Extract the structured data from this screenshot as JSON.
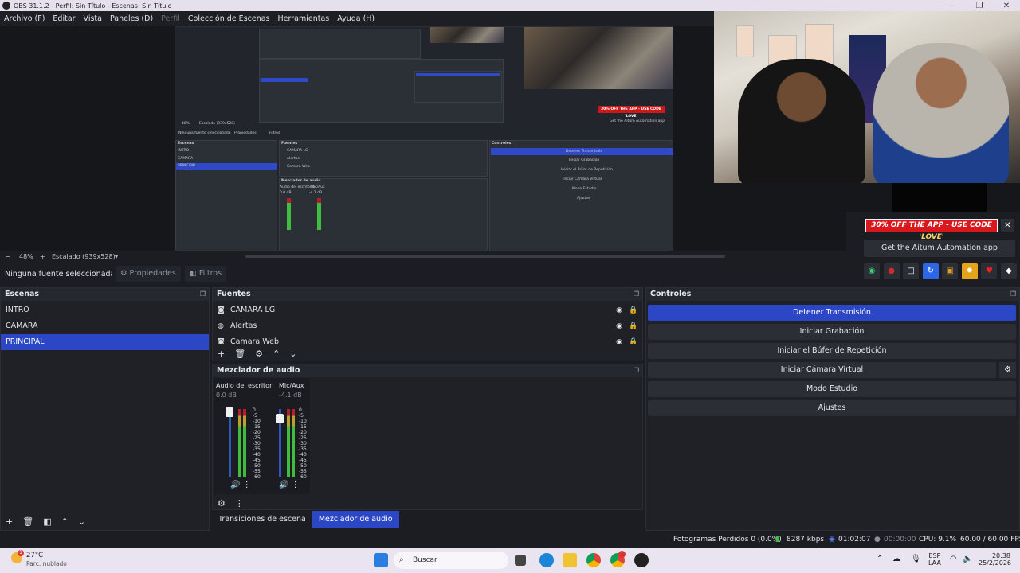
{
  "window": {
    "title": "OBS 31.1.2 - Perfil: Sin Título - Escenas: Sin Título",
    "minimize": "—",
    "maximize": "❐",
    "close": "✕"
  },
  "menu": [
    {
      "label": "Archivo (F)",
      "disabled": false
    },
    {
      "label": "Editar",
      "disabled": false
    },
    {
      "label": "Vista",
      "disabled": false
    },
    {
      "label": "Paneles (D)",
      "disabled": false
    },
    {
      "label": "Perfil",
      "disabled": true
    },
    {
      "label": "Colección de Escenas",
      "disabled": false
    },
    {
      "label": "Herramientas",
      "disabled": false
    },
    {
      "label": "Ayuda (H)",
      "disabled": false
    }
  ],
  "zoom": {
    "minus": "−",
    "level": "48%",
    "plus": "+",
    "scaled": "Escalado (939x528)",
    "dropdown": "▾"
  },
  "source_toolbar": {
    "no_source": "Ninguna fuente seleccionada",
    "properties": "Propiedades",
    "filters": "Filtros"
  },
  "promo": {
    "text": "30% OFF THE APP - USE CODE ",
    "code": "'LOVE'",
    "close": "✕",
    "aitum_button": "Get the Aitum Automation app"
  },
  "scenes": {
    "title": "Escenas",
    "items": [
      "INTRO",
      "CAMARA",
      "PRINCIPAL"
    ],
    "active_index": 2
  },
  "sources": {
    "title": "Fuentes",
    "items": [
      "CAMARA LG",
      "Alertas",
      "Camara Web"
    ]
  },
  "mixer": {
    "title": "Mezclador de audio",
    "channels": [
      {
        "name": "Audio del escritorio",
        "db": "0.0 dB"
      },
      {
        "name": "Mic/Aux",
        "db": "-4.1 dB"
      }
    ],
    "scale": [
      "0",
      "-5",
      "-10",
      "-15",
      "-20",
      "-25",
      "-30",
      "-35",
      "-40",
      "-45",
      "-50",
      "-55",
      "-60"
    ]
  },
  "tabs": [
    "Transiciones de escena",
    "Mezclador de audio"
  ],
  "active_tab": 1,
  "controls": {
    "title": "Controles",
    "buttons": [
      "Detener Transmisión",
      "Iniciar Grabación",
      "Iniciar el Búfer de Repetición",
      "Iniciar Cámara Virtual",
      "Modo Estudio",
      "Ajustes"
    ]
  },
  "status": {
    "dropped": "Fotogramas Perdidos 0 (0.0%)",
    "kbps": "8287 kbps",
    "stream_time": "01:02:07",
    "rec_time": "00:00:00",
    "cpu": "CPU: 9.1%",
    "fps": "60.00 / 60.00 FPS"
  },
  "taskbar": {
    "temp": "27°C",
    "weather_desc": "Parc. nublado",
    "weather_badge": "1",
    "search_placeholder": "Buscar",
    "lang_top": "ESP",
    "lang_bottom": "LAA",
    "time": "20:38",
    "date": "25/2/2026",
    "chrome_badge": "1"
  },
  "nested_preview": {
    "controls": [
      "Detener Transmisión",
      "Iniciar Grabación",
      "Iniciar el Búfer de Repetición",
      "Iniciar Cámara Virtual",
      "Modo Estudio",
      "Ajustes"
    ],
    "scenes": [
      "INTRO",
      "CAMARA",
      "PRINCIPAL"
    ],
    "sources": [
      "CAMARA LG",
      "Alertas",
      "Camara Web"
    ],
    "promo": "30% OFF THE APP - USE CODE 'LOVE'",
    "aitum": "Get the Aitum Automation app",
    "no_source": "Ninguna fuente seleccionada",
    "zoom": "48%",
    "scaled": "Escalado (939x528)",
    "properties": "Propiedades",
    "filters": "Filtros",
    "h_scenes": "Escenas",
    "h_sources": "Fuentes",
    "h_controls": "Controles",
    "h_mixer": "Mezclador de audio",
    "mix_desktop": "Audio del escritorio",
    "mix_mic": "Mic/Aux",
    "mix_db1": "0.0 dB",
    "mix_db2": "-4.1 dB"
  }
}
